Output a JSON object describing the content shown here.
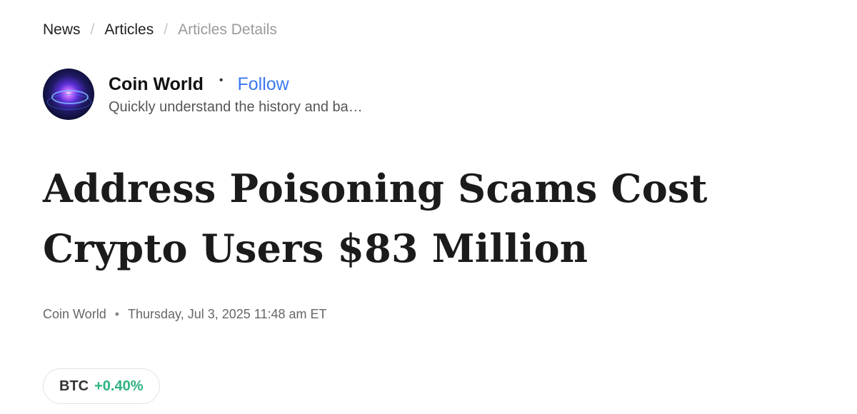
{
  "breadcrumb": {
    "items": [
      {
        "label": "News"
      },
      {
        "label": "Articles"
      },
      {
        "label": "Articles Details"
      }
    ],
    "separator": "/"
  },
  "author": {
    "name": "Coin World",
    "dot": "•",
    "follow_label": "Follow",
    "description": "Quickly understand the history and ba…"
  },
  "article": {
    "title": "Address Poisoning Scams Cost Crypto Users $83 Million",
    "source": "Coin World",
    "meta_dot": "•",
    "date": "Thursday, Jul 3, 2025 11:48 am ET"
  },
  "ticker": {
    "symbol": "BTC",
    "change": "+0.40%"
  },
  "colors": {
    "follow": "#3a78f0",
    "positive": "#2fb380"
  }
}
